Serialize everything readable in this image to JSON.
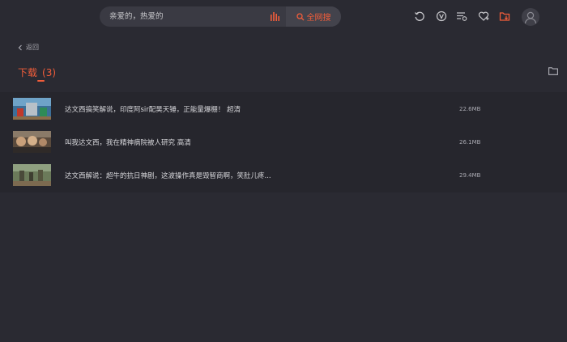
{
  "search": {
    "placeholder": "亲爱的，热爱的",
    "button_label": "全网搜"
  },
  "icons": [
    "refresh-icon",
    "vip-icon",
    "playlist-icon",
    "favorite-icon",
    "download-icon",
    "avatar-icon"
  ],
  "nav": {
    "back_label": "返回"
  },
  "page": {
    "title": "下载",
    "count": "(3)"
  },
  "downloads": [
    {
      "title": "达文西搞笑解说，印度阿sir配昊天锤，正能量爆棚！ 超清",
      "size": "22.6MB"
    },
    {
      "title": "叫我达文西，我在精神病院被人研究 高清",
      "size": "26.1MB"
    },
    {
      "title": "达文西解说：超牛的抗日神剧，这波操作真是毁智商啊，笑肚儿疼...",
      "size": "29.4MB"
    }
  ],
  "colors": {
    "accent": "#f25d3a",
    "background": "#2a2a32",
    "list_background": "#26262d"
  }
}
